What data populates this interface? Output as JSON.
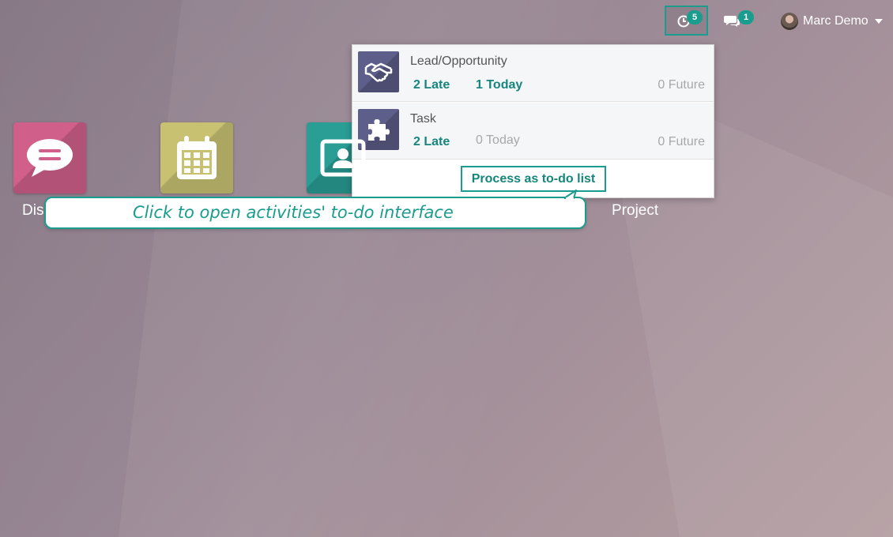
{
  "topbar": {
    "activity_count": "5",
    "message_count": "1",
    "user_name": "Marc Demo"
  },
  "apps": [
    {
      "label": "Dis",
      "icon": "chat-bubble-icon",
      "color": "#d05f8a"
    },
    {
      "label": "",
      "icon": "calendar-icon",
      "color": "#c7c171"
    },
    {
      "label": "",
      "icon": "contact-card-icon",
      "color": "#2a9d94"
    },
    {
      "label": "Project",
      "icon": "",
      "color": ""
    }
  ],
  "activities": [
    {
      "name": "Lead/Opportunity",
      "late": "2 Late",
      "today": "1 Today",
      "future": "0 Future",
      "icon": "handshake-icon"
    },
    {
      "name": "Task",
      "late": "2 Late",
      "today": "0 Today",
      "future": "0 Future",
      "icon": "puzzle-icon"
    }
  ],
  "process_label": "Process as to-do list",
  "tooltip": "Click to open activities' to-do interface",
  "colors": {
    "accent": "#1a9c8e",
    "activity_icon_bg": "#5d5e8a"
  }
}
